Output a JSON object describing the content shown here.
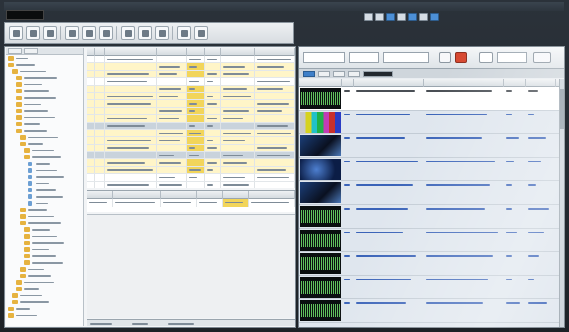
{
  "window": {
    "timecode_display": "",
    "legibility": "unreadable"
  },
  "menubar": {
    "items": [
      "",
      "",
      "",
      "",
      "",
      "",
      "",
      "",
      ""
    ]
  },
  "toolbar": {
    "tools": [
      "open-icon",
      "save-icon",
      "print-icon",
      "cut-icon",
      "copy-icon",
      "paste-icon",
      "undo-icon",
      "redo-icon",
      "find-icon",
      "filter-icon",
      "settings-icon"
    ]
  },
  "transport": {
    "buttons": [
      "rewind-icon",
      "stop-icon",
      "play-icon",
      "pause-icon",
      "forward-icon",
      "record-icon",
      "loop-icon"
    ]
  },
  "tree": {
    "rows": 40
  },
  "grid": {
    "columns": [
      "",
      "",
      "",
      "",
      "",
      "",
      "",
      ""
    ],
    "rows": 18,
    "highlight_color": "#fff5c8",
    "cell_highlight_color": "#f2d55a"
  },
  "detail": {
    "columns": [
      "",
      "",
      "",
      "",
      "",
      ""
    ]
  },
  "statusbar": {
    "fields": [
      "",
      "",
      ""
    ]
  },
  "media_browser": {
    "columns": [
      "",
      "",
      "",
      "",
      ""
    ],
    "items": [
      {
        "thumb": "audio",
        "link": "",
        "type": ""
      },
      {
        "thumb": "video-bars",
        "link": "",
        "type": ""
      },
      {
        "thumb": "video-dark",
        "link": "",
        "type": ""
      },
      {
        "thumb": "video-blue",
        "link": "",
        "type": ""
      },
      {
        "thumb": "video-dark",
        "link": "",
        "type": ""
      },
      {
        "thumb": "audio",
        "link": "",
        "type": ""
      },
      {
        "thumb": "audio",
        "link": "",
        "type": ""
      },
      {
        "thumb": "audio",
        "link": "",
        "type": ""
      },
      {
        "thumb": "audio",
        "link": "",
        "type": ""
      },
      {
        "thumb": "audio",
        "link": "",
        "type": ""
      }
    ],
    "accent_color": "#3f80c9",
    "waveform_color": "#6fe06a"
  }
}
